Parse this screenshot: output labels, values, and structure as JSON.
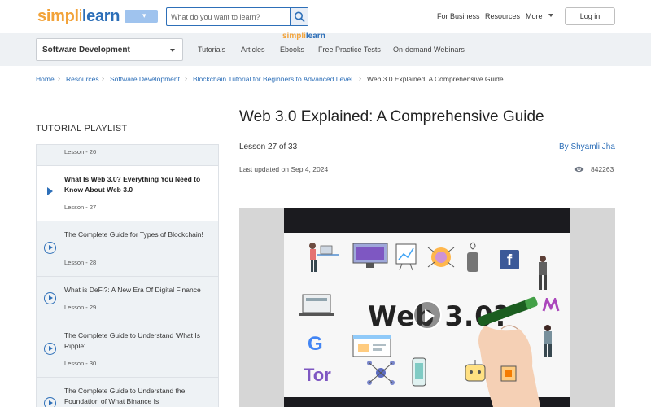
{
  "header": {
    "logo_simpl": "simpl",
    "logo_bar": "i",
    "logo_learn": "learn",
    "search_placeholder": "What do you want to learn?",
    "nav": [
      "For Business",
      "Resources",
      "More"
    ],
    "login_label": "Log in"
  },
  "subnav": {
    "category": "Software Development",
    "tabs": [
      "Tutorials",
      "Articles",
      "Ebooks",
      "Free Practice Tests",
      "On-demand Webinars"
    ]
  },
  "breadcrumb": [
    "Home",
    "Resources",
    "Software Development",
    "Blockchain Tutorial for Beginners to Advanced Level",
    "Web 3.0 Explained: A Comprehensive Guide"
  ],
  "playlist": {
    "title": "TUTORIAL PLAYLIST",
    "items": [
      {
        "title": "",
        "lesson": "Lesson - 26"
      },
      {
        "title": "What Is Web 3.0? Everything You Need to Know About Web 3.0",
        "lesson": "Lesson - 27",
        "active": true
      },
      {
        "title": "The Complete Guide for Types of Blockchain!",
        "lesson": "Lesson - 28"
      },
      {
        "title": "What is DeFi?: A New Era Of Digital Finance",
        "lesson": "Lesson - 29"
      },
      {
        "title": "The Complete Guide to Understand 'What Is Ripple'",
        "lesson": "Lesson - 30"
      },
      {
        "title": "The Complete Guide to Understand the Foundation of What Binance Is",
        "lesson": ""
      }
    ]
  },
  "article": {
    "title": "Web 3.0 Explained: A Comprehensive Guide",
    "lesson_no": "Lesson 27 of 33",
    "author": "By Shyamli Jha",
    "updated": "Last updated on Sep 4, 2024",
    "views": "842263"
  },
  "video": {
    "logo_s": "simpl",
    "logo_i": "i",
    "logo_l": "learn",
    "headline": "Web 3.0?"
  },
  "colors": {
    "accent": "#2d6fb8",
    "logo_orange": "#f2a33a"
  }
}
